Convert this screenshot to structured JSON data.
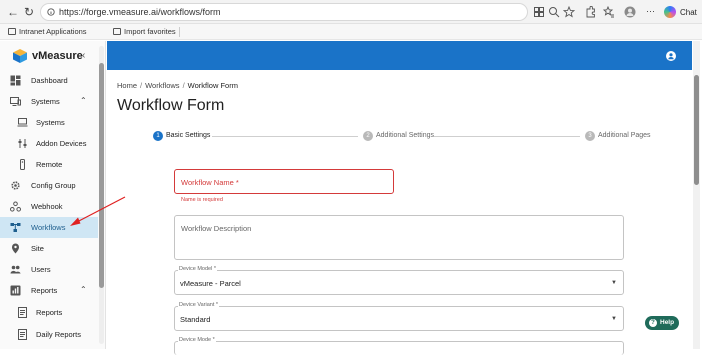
{
  "browser": {
    "url": "https://forge.vmeasure.ai/workflows/form",
    "chat_label": "Chat",
    "favorites": [
      {
        "label": "Intranet Applications",
        "icon": "folder-icon"
      },
      {
        "label": "Import favorites",
        "icon": "import-icon"
      }
    ]
  },
  "sidebar": {
    "brand": "vMeasure",
    "items": [
      {
        "label": "Dashboard",
        "icon": "dashboard-icon"
      },
      {
        "label": "Systems",
        "icon": "monitor-icon",
        "expandable": true
      },
      {
        "label": "Systems",
        "icon": "computer-icon"
      },
      {
        "label": "Addon Devices",
        "icon": "devices-icon"
      },
      {
        "label": "Remote",
        "icon": "remote-icon"
      },
      {
        "label": "Config Group",
        "icon": "gear-icon"
      },
      {
        "label": "Webhook",
        "icon": "webhook-icon"
      },
      {
        "label": "Workflows",
        "icon": "workflow-icon",
        "active": true
      },
      {
        "label": "Site",
        "icon": "location-pin-icon"
      },
      {
        "label": "Users",
        "icon": "users-icon"
      },
      {
        "label": "Reports",
        "icon": "reports-icon",
        "expandable": true
      },
      {
        "label": "Reports",
        "icon": "report-doc-icon"
      },
      {
        "label": "Daily Reports",
        "icon": "daily-report-icon"
      }
    ]
  },
  "breadcrumb": [
    "Home",
    "Workflows",
    "Workflow Form"
  ],
  "page_title": "Workflow Form",
  "stepper": [
    {
      "number": "1",
      "label": "Basic Settings",
      "active": true
    },
    {
      "number": "2",
      "label": "Additional Settings",
      "active": false
    },
    {
      "number": "3",
      "label": "Additional Pages",
      "active": false
    }
  ],
  "form": {
    "workflow_name": {
      "placeholder": "Workflow Name *",
      "error": "Name is required"
    },
    "workflow_description": {
      "placeholder": "Workflow Description"
    },
    "device_model": {
      "label": "Device Model *",
      "value": "vMeasure - Parcel"
    },
    "device_variant": {
      "label": "Device Variant *",
      "value": "Standard"
    },
    "device_mode": {
      "label": "Device Mode *"
    }
  },
  "help_label": "Help",
  "colors": {
    "header_blue": "#1a73c8",
    "active_nav_bg": "#cfe6f4",
    "error_red": "#d43a3a",
    "help_green": "#1f6b5a",
    "annotation_arrow": "#e02020"
  }
}
